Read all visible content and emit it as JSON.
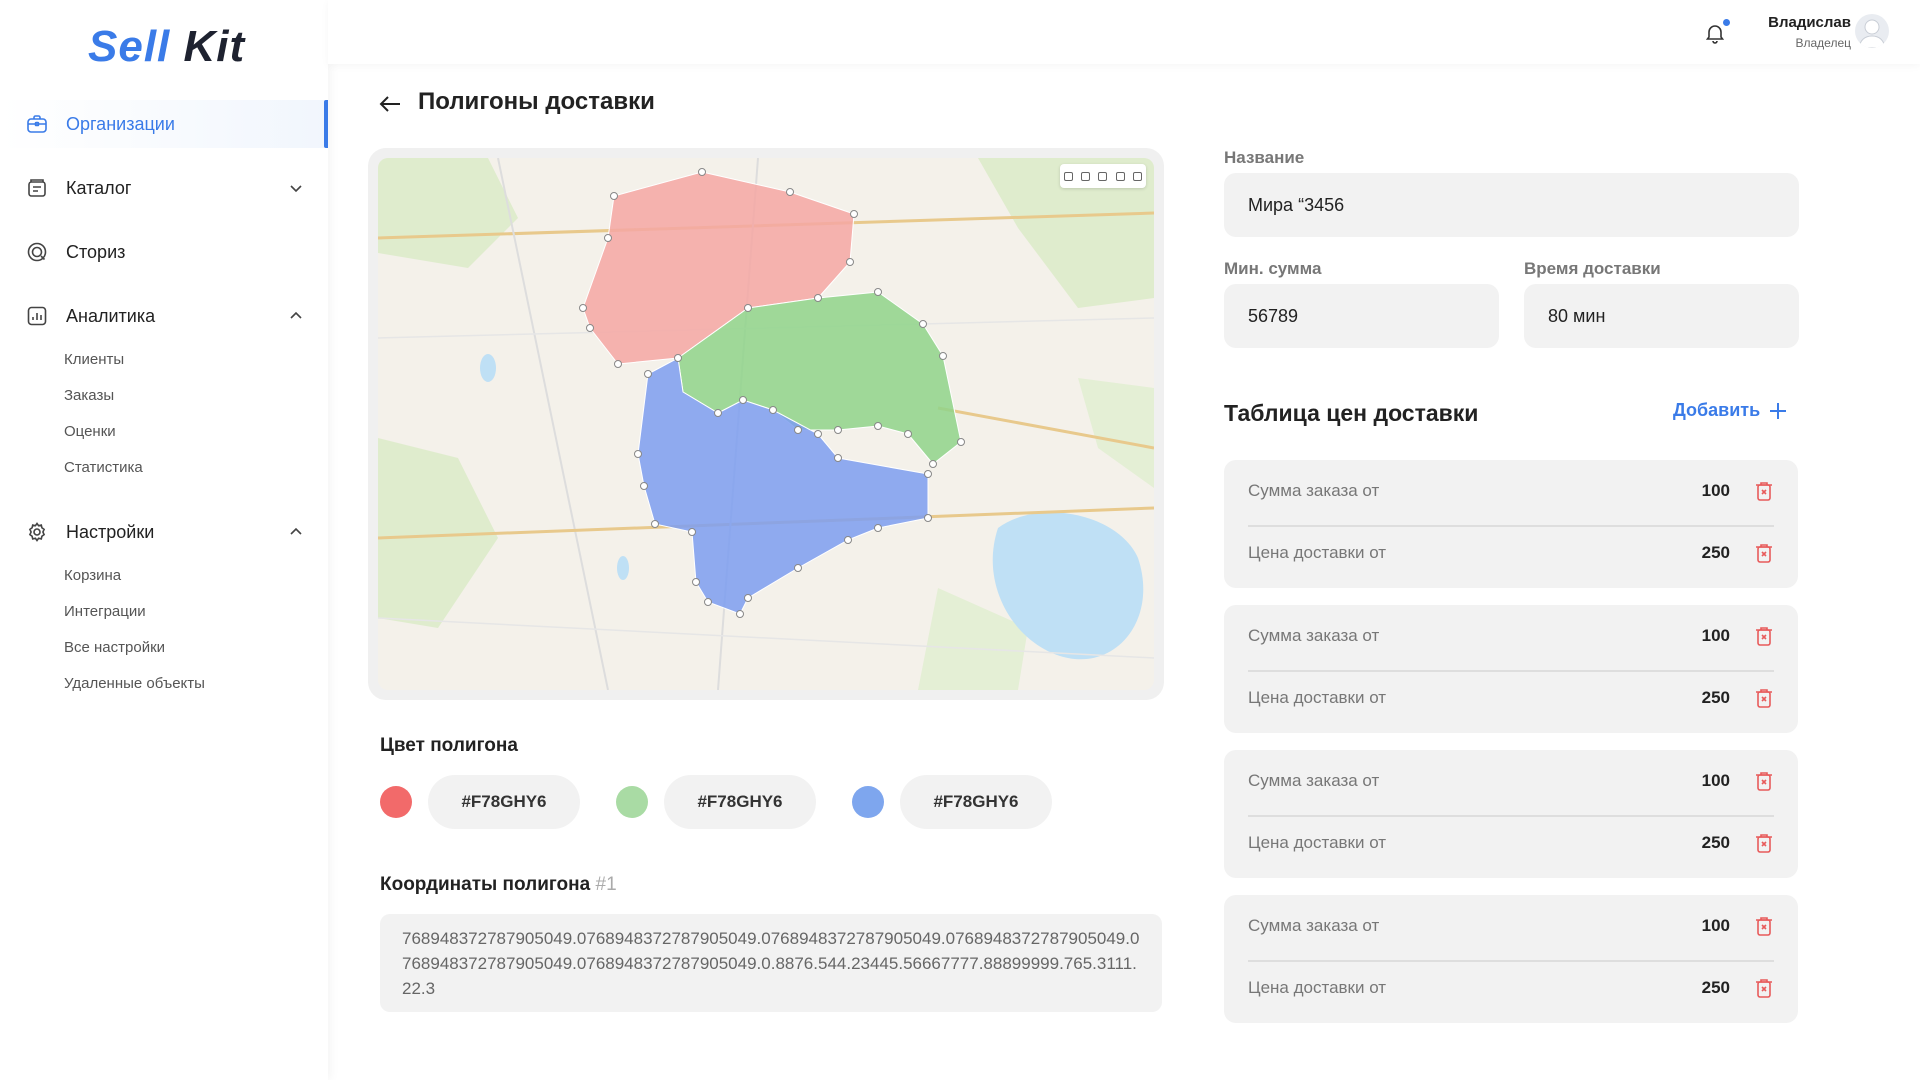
{
  "brand": {
    "part1": "Sell",
    "part2": "Kit"
  },
  "sidebar": {
    "items": [
      {
        "label": "Организации",
        "icon": "briefcase-icon",
        "active": true
      },
      {
        "label": "Каталог",
        "icon": "catalog-icon"
      },
      {
        "label": "Сториз",
        "icon": "stories-icon"
      },
      {
        "label": "Аналитика",
        "icon": "analytics-icon"
      },
      {
        "label": "Настройки",
        "icon": "gear-icon"
      }
    ],
    "analytics_sub": [
      "Клиенты",
      "Заказы",
      "Оценки",
      "Статистика"
    ],
    "settings_sub": [
      "Корзина",
      "Интеграции",
      "Все настройки",
      "Удаленные объекты"
    ]
  },
  "header": {
    "user_name": "Владислав",
    "user_role": "Владелец"
  },
  "page": {
    "title": "Полигоны доставки"
  },
  "polygon_colors": {
    "label": "Цвет полигона",
    "items": [
      {
        "swatch": "#f26a6a",
        "code": "#F78GHY6"
      },
      {
        "swatch": "#a9dba4",
        "code": "#F78GHY6"
      },
      {
        "swatch": "#7ea6ee",
        "code": "#F78GHY6"
      }
    ]
  },
  "coordinates": {
    "label": "Координаты полигона",
    "number": "#1",
    "value": "768948372787905049.076894837278790504​9.0768948372787905049.0768948372787905049.0768948372787905049.0768948372787905049.0.8876.544.23445.56667777.88899999.765.3111.22.3"
  },
  "form": {
    "name_label": "Название",
    "name_value": "Мира “3456",
    "min_sum_label": "Мин. сумма",
    "min_sum_value": "56789",
    "delivery_time_label": "Время доставки",
    "delivery_time_value": "80 мин"
  },
  "price_table": {
    "title": "Таблица цен доставки",
    "add_label": "Добавить",
    "cards": [
      {
        "order_label": "Сумма заказа от",
        "order_value": "100",
        "delivery_label": "Цена доставки от",
        "delivery_value": "250"
      },
      {
        "order_label": "Сумма заказа от",
        "order_value": "100",
        "delivery_label": "Цена доставки от",
        "delivery_value": "250"
      },
      {
        "order_label": "Сумма заказа от",
        "order_value": "100",
        "delivery_label": "Цена доставки от",
        "delivery_value": "250"
      },
      {
        "order_label": "Сумма заказа от",
        "order_value": "100",
        "delivery_label": "Цена доставки от",
        "delivery_value": "250"
      }
    ]
  },
  "colors": {
    "accent": "#3a7be8",
    "danger": "#e85b5b",
    "poly_red": "#f5a7a3",
    "poly_green": "#8fd38a",
    "poly_blue": "#7d9ef0"
  }
}
